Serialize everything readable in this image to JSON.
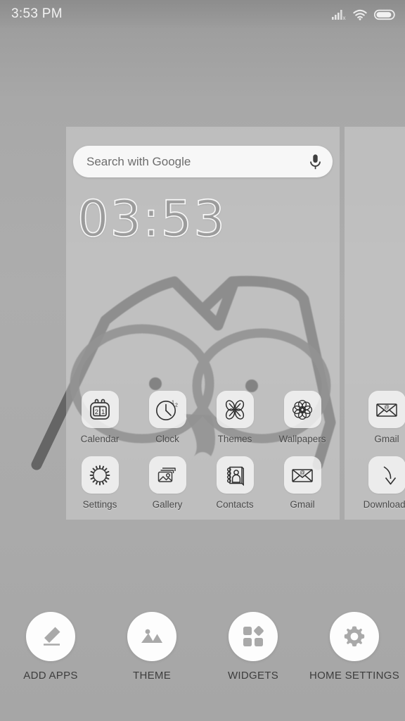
{
  "statusbar": {
    "time": "3:53 PM",
    "icons": [
      "signal-no-sim-icon",
      "wifi-icon",
      "battery-icon"
    ],
    "text_color": "#f2f2f2"
  },
  "wallpaper": {
    "description": "hand-drawn owl face line art",
    "line_color": "#5e5e5e",
    "background_colors": [
      "#9a9a9a",
      "#adadad",
      "#a6a6a6"
    ]
  },
  "search": {
    "placeholder": "Search with Google",
    "mic_icon": "microphone-icon",
    "pill_color": "#f7f7f7"
  },
  "clock_widget": {
    "time": "03:53",
    "style": "outline"
  },
  "pages": [
    {
      "name": "page-1",
      "rows": [
        [
          {
            "label": "Calendar",
            "icon": "calendar-icon"
          },
          {
            "label": "Clock",
            "icon": "analog-clock-icon"
          },
          {
            "label": "Themes",
            "icon": "butterfly-icon"
          },
          {
            "label": "Wallpapers",
            "icon": "flower-mandala-icon"
          }
        ],
        [
          {
            "label": "Settings",
            "icon": "gear-icon"
          },
          {
            "label": "Gallery",
            "icon": "photos-icon"
          },
          {
            "label": "Contacts",
            "icon": "contacts-notebook-icon"
          },
          {
            "label": "Gmail",
            "icon": "envelope-at-icon"
          }
        ]
      ]
    },
    {
      "name": "page-2",
      "rows": [
        [
          {
            "label": "Gmail",
            "icon": "envelope-at-icon"
          }
        ],
        [
          {
            "label": "Downloads",
            "icon": "download-arrow-icon"
          }
        ]
      ]
    }
  ],
  "toolbar": {
    "items": [
      {
        "label": "ADD APPS",
        "icon": "pencil-icon"
      },
      {
        "label": "THEME",
        "icon": "image-mountain-icon"
      },
      {
        "label": "WIDGETS",
        "icon": "widgets-squares-icon"
      },
      {
        "label": "HOME SETTINGS",
        "icon": "gear-icon"
      }
    ],
    "circle_color": "#fdfdfd",
    "icon_color": "#a9a9a9",
    "label_color": "#3d3d3d"
  }
}
